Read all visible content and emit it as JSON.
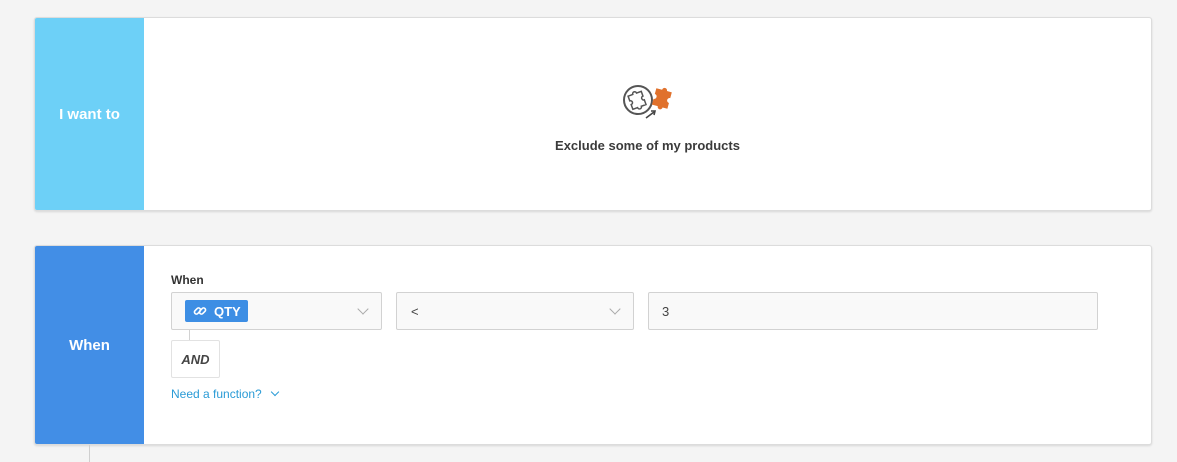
{
  "want_card": {
    "side_label": "I want to",
    "goal_icon": "puzzle-exclude-icon",
    "goal_label": "Exclude some of my products"
  },
  "when_card": {
    "side_label": "When",
    "field_title": "When",
    "attribute": {
      "icon": "link-icon",
      "tag": "QTY"
    },
    "operator": "<",
    "value": "3",
    "and_label": "AND",
    "function_link": "Need a function?"
  },
  "colors": {
    "want_side": "#6dd0f7",
    "when_side": "#428ee6",
    "tag": "#3d8ee4",
    "link": "#2a9bd6",
    "puzzle_accent": "#e0712c"
  }
}
